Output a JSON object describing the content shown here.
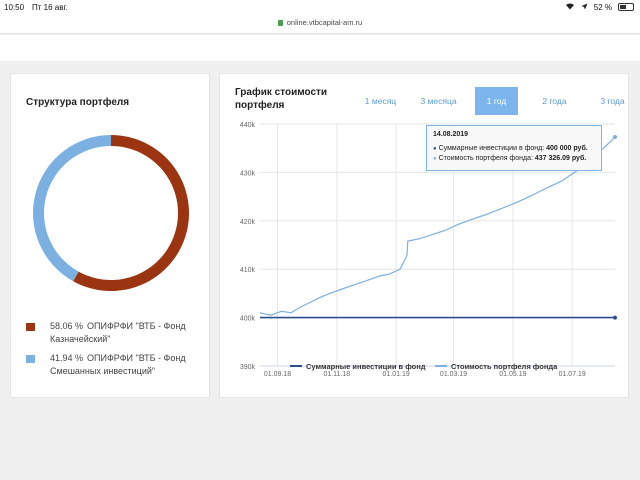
{
  "statusbar": {
    "time": "10:50",
    "date": "Пт 16 авг.",
    "battery": "52 %",
    "battery_fraction": 0.52
  },
  "browser": {
    "url": "online.vtbcapital-am.ru"
  },
  "portfolio": {
    "title": "Структура портфеля",
    "items": [
      {
        "percent": "58.06 %",
        "name": "ОПИФРФИ \"ВТБ - Фонд Казначейский\"",
        "value": 58.06,
        "color": "#9b3410"
      },
      {
        "percent": "41.94 %",
        "name": "ОПИФРФИ \"ВТБ - Фонд Смешанных инвестиций\"",
        "value": 41.94,
        "color": "#7cb0e0"
      }
    ]
  },
  "value_chart": {
    "title": "График стоимости портфеля",
    "tabs": [
      "1 месяц",
      "3 месяца",
      "1 год",
      "2 года",
      "3 года"
    ],
    "active_tab": "1 год",
    "tooltip": {
      "date": "14.08.2019",
      "line1_label": "Суммарные инвестиции в фонд:",
      "line1_value": "400 000 руб.",
      "line2_label": "Стоимость портфеля фонда:",
      "line2_value": "437 326.09 руб."
    }
  },
  "chart_data": {
    "type": "line",
    "title": "График стоимости портфеля",
    "ylim": [
      390000,
      440000
    ],
    "y_ticks": [
      390000,
      400000,
      410000,
      420000,
      430000,
      440000
    ],
    "y_tick_labels": [
      "390k",
      "400k",
      "410k",
      "420k",
      "430k",
      "440k"
    ],
    "x_tick_labels": [
      "01.09.18",
      "01.11.18",
      "01.01.19",
      "01.03.19",
      "01.05.19",
      "01.07.19"
    ],
    "x_ticks": [
      "2018-09-01",
      "2018-11-01",
      "2019-01-01",
      "2019-03-01",
      "2019-05-01",
      "2019-07-01"
    ],
    "x_range": [
      "2018-08-14",
      "2019-08-14"
    ],
    "grid": true,
    "legend_position": "bottom",
    "series": [
      {
        "name": "Суммарные инвестиции в фонд",
        "color": "#2e4f8f",
        "points": [
          [
            "2018-08-14",
            400000
          ],
          [
            "2019-08-14",
            400000
          ]
        ]
      },
      {
        "name": "Стоимость портфеля фонда",
        "color": "#7cb0e0",
        "points": [
          [
            "2018-08-14",
            401000
          ],
          [
            "2018-08-25",
            400500
          ],
          [
            "2018-09-05",
            401300
          ],
          [
            "2018-09-15",
            401000
          ],
          [
            "2018-09-25",
            402200
          ],
          [
            "2018-10-05",
            403200
          ],
          [
            "2018-10-15",
            404200
          ],
          [
            "2018-10-25",
            405000
          ],
          [
            "2018-11-05",
            405800
          ],
          [
            "2018-11-15",
            406500
          ],
          [
            "2018-11-25",
            407200
          ],
          [
            "2018-12-05",
            407900
          ],
          [
            "2018-12-15",
            408600
          ],
          [
            "2018-12-25",
            409000
          ],
          [
            "2019-01-05",
            410000
          ],
          [
            "2019-01-12",
            412800
          ],
          [
            "2019-01-13",
            415800
          ],
          [
            "2019-01-25",
            416300
          ],
          [
            "2019-02-05",
            417000
          ],
          [
            "2019-02-20",
            418000
          ],
          [
            "2019-03-05",
            419200
          ],
          [
            "2019-03-20",
            420300
          ],
          [
            "2019-04-05",
            421400
          ],
          [
            "2019-04-20",
            422600
          ],
          [
            "2019-05-05",
            423800
          ],
          [
            "2019-05-20",
            425200
          ],
          [
            "2019-06-05",
            426800
          ],
          [
            "2019-06-20",
            428200
          ],
          [
            "2019-07-05",
            430200
          ],
          [
            "2019-07-20",
            432600
          ],
          [
            "2019-08-01",
            434800
          ],
          [
            "2019-08-10",
            436500
          ],
          [
            "2019-08-14",
            437326.09
          ]
        ]
      }
    ]
  }
}
